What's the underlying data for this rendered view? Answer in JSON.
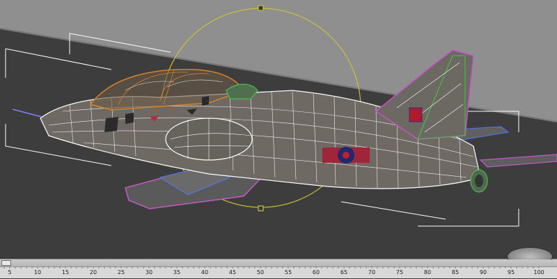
{
  "viewport": {
    "ground_color": "#8f8f8f",
    "background_color": "#3d3d3d",
    "wireframe_color": "#ffffff",
    "gizmo_color": "#c9c23a",
    "model_colors": {
      "canopy": "#d8822a",
      "tail": "#d04fd0",
      "wing": "#c45cc4",
      "intake": "#45c445",
      "blue_edges": "#4a7cff"
    }
  },
  "timeline": {
    "slider_position_frame": 0,
    "ruler_ticks": [
      "5",
      "10",
      "15",
      "20",
      "25",
      "30",
      "35",
      "40",
      "45",
      "50",
      "55",
      "60",
      "65",
      "70",
      "75",
      "80",
      "85",
      "90",
      "95",
      "100"
    ]
  }
}
